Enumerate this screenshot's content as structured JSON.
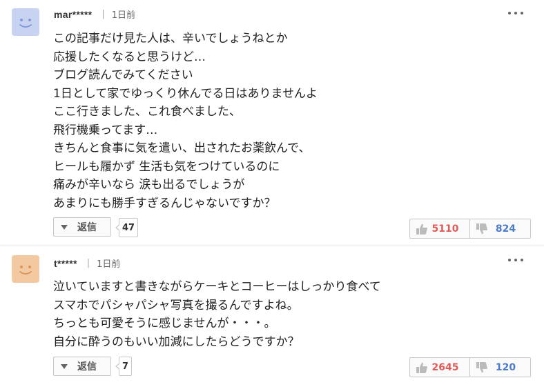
{
  "comments": [
    {
      "user": "mar*****",
      "separator": "|",
      "time": "1日前",
      "avatar_color": "#c7d3f0",
      "lines": [
        "この記事だけ見た人は、辛いでしょうねとか",
        "応援したくなると思うけど…",
        "ブログ読んでみてください",
        "1日として家でゆっくり休んでる日はありませんよ",
        "ここ行きました、これ食べました、",
        "飛行機乗ってます…",
        "きちんと食事に気を遣い、出されたお薬飲んで、",
        "ヒールも履かず 生活も気をつけているのに",
        "痛みが辛いなら 涙も出るでしょうが",
        "あまりにも勝手すぎるんじゃないですか？"
      ],
      "reply_label": "返信",
      "reply_count": "47",
      "likes": "5110",
      "dislikes": "824"
    },
    {
      "user": "t*****",
      "separator": "|",
      "time": "1日前",
      "avatar_color": "#f2c9a0",
      "lines": [
        "泣いていますと書きながらケーキとコーヒーはしっかり食べて",
        "スマホでパシャパシャ写真を撮るんですよね。",
        "ちっとも可愛そうに感じませんが・・・。",
        "自分に酔うのもいい加減にしたらどうですか？"
      ],
      "reply_label": "返信",
      "reply_count": "7",
      "likes": "2645",
      "dislikes": "120"
    }
  ],
  "colors": {
    "like": "#e05a5a",
    "dislike": "#4c7bc7"
  },
  "icons": {
    "more": "more-options-icon",
    "like": "thumbs-up-icon",
    "dislike": "thumbs-down-icon",
    "reply": "caret-down-icon"
  }
}
